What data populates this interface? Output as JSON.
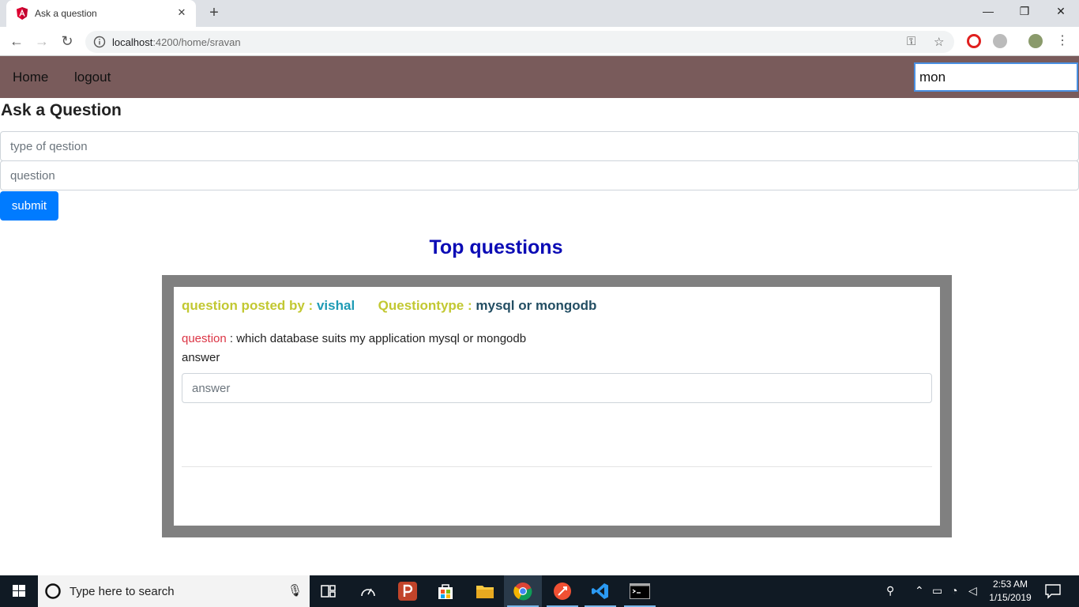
{
  "browser": {
    "tab_title": "Ask a question",
    "url_host": "localhost",
    "url_path": ":4200/home/sravan"
  },
  "navbar": {
    "home_label": "Home",
    "logout_label": "logout",
    "search_value": "mon"
  },
  "ask_form": {
    "title": "Ask a Question",
    "type_placeholder": "type of qestion",
    "question_placeholder": "question",
    "submit_label": "submit"
  },
  "top_questions": {
    "heading": "Top questions",
    "items": [
      {
        "posted_by_label": "question posted by :",
        "posted_by": "vishal",
        "type_label": "Questiontype :",
        "type": "mysql or mongodb",
        "question_label": "question",
        "question_text": ": which database suits my application mysql or mongodb",
        "answer_label": "answer",
        "answer_placeholder": "answer"
      }
    ]
  },
  "taskbar": {
    "search_placeholder": "Type here to search",
    "time": "2:53 AM",
    "date": "1/15/2019"
  },
  "colors": {
    "navbar_bg": "#795b5b",
    "submit_bg": "#007bff",
    "top_questions_heading": "#0b0bb5",
    "card_frame": "#808080",
    "label_yellow": "#c2c832",
    "value_teal": "#1e9bb5",
    "value_dark": "#234e63",
    "label_red": "#dc3545"
  }
}
